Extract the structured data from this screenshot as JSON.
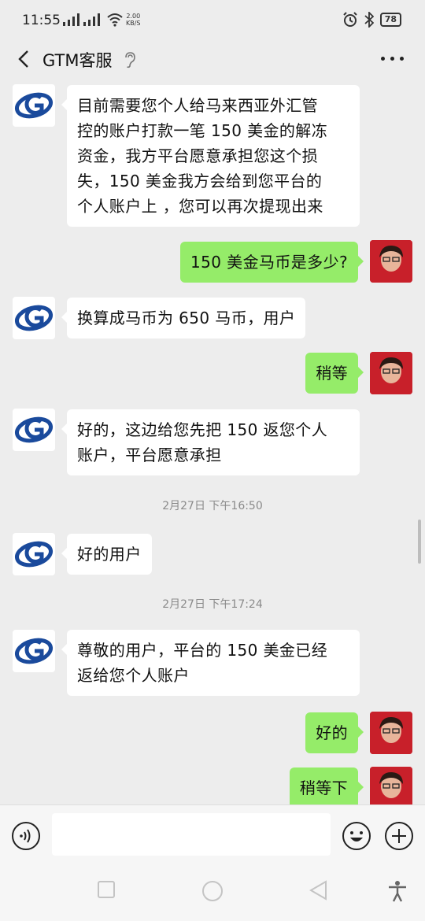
{
  "status_bar": {
    "time": "11:55",
    "speed_value": "2.00",
    "speed_unit": "KB/S",
    "battery": "78",
    "icons": [
      "signal-icon",
      "signal-icon",
      "wifi-icon",
      "alarm-icon",
      "bluetooth-icon",
      "battery-icon"
    ]
  },
  "header": {
    "title": "GTM客服",
    "icons": [
      "back-arrow-icon",
      "ear-icon",
      "more-icon"
    ]
  },
  "messages": [
    {
      "side": "left",
      "sender": "GTM客服",
      "lines": [
        "目前需要您个人给马来西亚外汇管",
        "控的账户打款一笔 150 美金的解冻",
        "资金，我方平台愿意承担您这个损",
        "失，150 美金我方会给到您平台的",
        "个人账户上 ，您可以再次提现出来"
      ]
    },
    {
      "side": "right",
      "sender": "user",
      "lines": [
        "150 美金马币是多少?"
      ]
    },
    {
      "side": "left",
      "sender": "GTM客服",
      "lines": [
        "换算成马币为 650 马币，用户"
      ]
    },
    {
      "side": "right",
      "sender": "user",
      "lines": [
        "稍等"
      ]
    },
    {
      "side": "left",
      "sender": "GTM客服",
      "lines": [
        "好的，这边给您先把 150 返您个人",
        "账户，平台愿意承担"
      ]
    },
    {
      "type": "timestamp",
      "text": "2月27日 下午16:50"
    },
    {
      "side": "left",
      "sender": "GTM客服",
      "lines": [
        "好的用户"
      ]
    },
    {
      "type": "timestamp",
      "text": "2月27日 下午17:24"
    },
    {
      "side": "left",
      "sender": "GTM客服",
      "lines": [
        "尊敬的用户，平台的 150 美金已经",
        "返给您个人账户"
      ]
    },
    {
      "side": "right",
      "sender": "user",
      "lines": [
        "好的"
      ]
    },
    {
      "side": "right",
      "sender": "user",
      "lines": [
        "稍等下"
      ]
    }
  ],
  "input_bar": {
    "value": "",
    "placeholder": "",
    "icons": [
      "voice-icon",
      "emoji-icon",
      "plus-icon"
    ]
  },
  "nav_bar": {
    "icons": [
      "square-nav-icon",
      "circle-nav-icon",
      "triangle-back-icon",
      "accessibility-icon"
    ]
  },
  "colors": {
    "background": "#ededed",
    "self_bubble": "#95ec69",
    "other_bubble": "#ffffff",
    "logo_blue": "#1a4a9c",
    "user_avatar": "#c8202a"
  }
}
